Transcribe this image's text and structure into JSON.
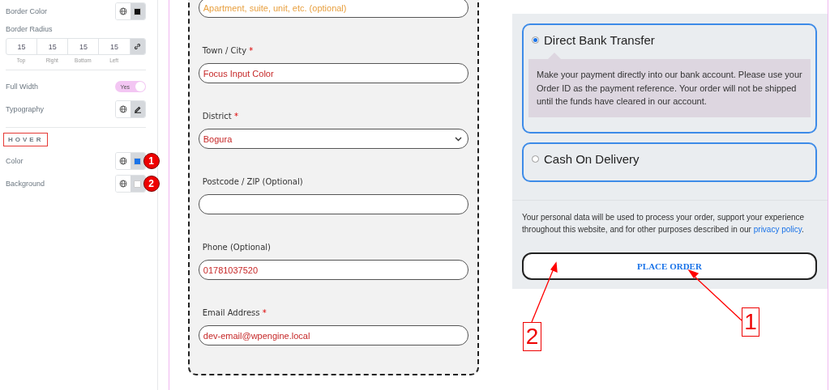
{
  "settings": {
    "rows_top": [
      {
        "kind": "color",
        "label": "Border Color",
        "color": "#111111"
      }
    ],
    "border_radius": {
      "label": "Border Radius",
      "linked": true,
      "values": [
        {
          "value": "15",
          "label": "Top"
        },
        {
          "value": "15",
          "label": "Right"
        },
        {
          "value": "15",
          "label": "Bottom"
        },
        {
          "value": "15",
          "label": "Left"
        }
      ]
    },
    "rows_mid": [
      {
        "kind": "toggle",
        "label": "Full Width",
        "on": true,
        "text": "Yes"
      },
      {
        "kind": "typography",
        "label": "Typography"
      }
    ],
    "hover_heading": "HOVER",
    "hover_rows": [
      {
        "kind": "color",
        "label": "Color",
        "color": "#1a73e8",
        "callout": "1"
      },
      {
        "kind": "color",
        "label": "Background",
        "color": "#ffffff",
        "callout": "2"
      }
    ]
  },
  "form": {
    "fields": [
      {
        "kind": "text",
        "placeholder": "Apartment, suite, unit, etc. (optional)"
      },
      {
        "kind": "text",
        "label": "Town / City",
        "required_mark": "*",
        "value": "Focus Input Color"
      },
      {
        "kind": "select",
        "label": "District",
        "required_mark": "*",
        "value": "Bogura"
      },
      {
        "kind": "text",
        "label": "Postcode / ZIP (Optional)"
      },
      {
        "kind": "text",
        "label": "Phone (Optional)",
        "value": "01781037520"
      },
      {
        "kind": "text",
        "label": "Email Address",
        "required_mark": "*",
        "value": "dev-email@wpengine.local"
      }
    ]
  },
  "payment": {
    "methods": [
      {
        "label": "Direct Bank Transfer",
        "selected": true,
        "description": "Make your payment directly into our bank account. Please use your Order ID as the payment reference. Your order will not be shipped until the funds have cleared in our account."
      },
      {
        "label": "Cash On Delivery",
        "selected": false
      }
    ],
    "privacy_text": "Your personal data will be used to process your order, support your experience throughout this website, and for other purposes described in our ",
    "privacy_link": "privacy policy",
    "privacy_end": ".",
    "button": "PLACE ORDER"
  },
  "annotations": [
    {
      "label": "1"
    },
    {
      "label": "2"
    }
  ]
}
